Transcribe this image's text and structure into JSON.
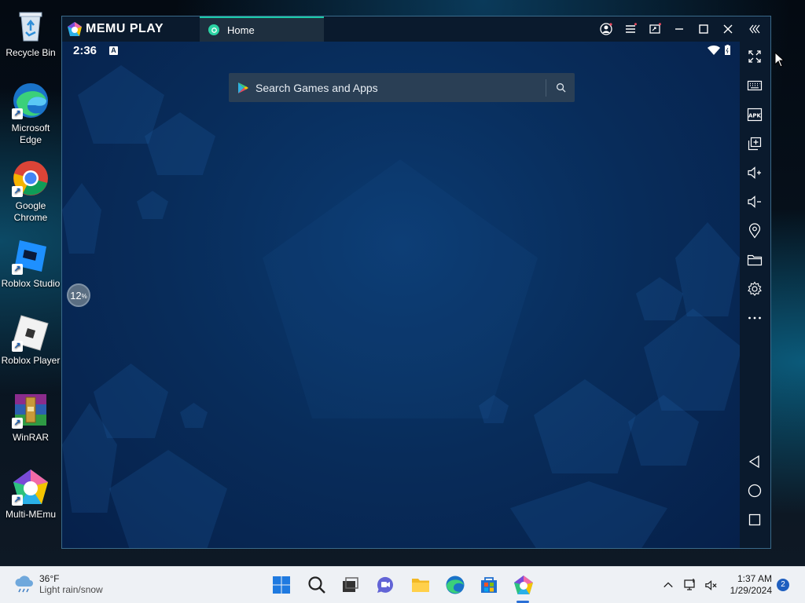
{
  "desktop": {
    "icons": [
      {
        "label": "Recycle Bin"
      },
      {
        "label": "Microsoft Edge"
      },
      {
        "label": "Google Chrome"
      },
      {
        "label": "Roblox Studio"
      },
      {
        "label": "Roblox Player"
      },
      {
        "label": "WinRAR"
      },
      {
        "label": "Multi-MEmu"
      }
    ]
  },
  "emulator": {
    "logo_text": "MEMU PLAY",
    "tab_label": "Home",
    "status_time": "2:36",
    "search_placeholder": "Search Games and Apps",
    "progress_value": "12",
    "progress_unit": "%",
    "accent_color": "#1bc9a8"
  },
  "taskbar": {
    "weather_temp": "36°F",
    "weather_desc": "Light rain/snow",
    "time": "1:37 AM",
    "date": "1/29/2024",
    "notification_count": "2"
  }
}
